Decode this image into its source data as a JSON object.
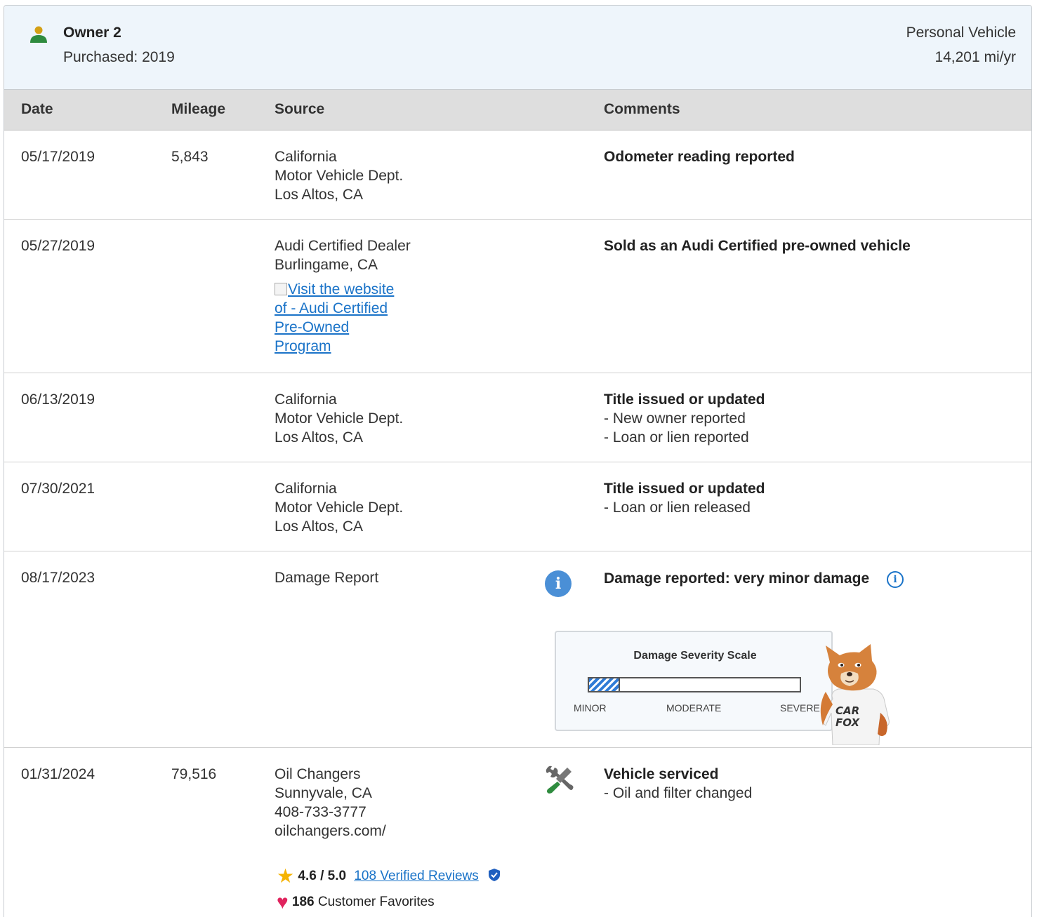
{
  "owner": {
    "title": "Owner 2",
    "purchased": "Purchased: 2019",
    "vehicle_type": "Personal Vehicle",
    "miles_per_year": "14,201 mi/yr"
  },
  "table": {
    "headers": {
      "date": "Date",
      "mileage": "Mileage",
      "source": "Source",
      "comments": "Comments"
    },
    "rows": [
      {
        "date": "05/17/2019",
        "mileage": "5,843",
        "source": [
          "California",
          "Motor Vehicle Dept.",
          "Los Altos, CA"
        ],
        "comment_title": "Odometer reading reported",
        "comment_items": []
      },
      {
        "date": "05/27/2019",
        "mileage": "",
        "source": [
          "Audi Certified Dealer",
          "Burlingame, CA"
        ],
        "link_text": "Visit the website of - Audi Certified Pre-Owned Program",
        "comment_title": "Sold as an Audi Certified pre-owned vehicle",
        "comment_items": []
      },
      {
        "date": "06/13/2019",
        "mileage": "",
        "source": [
          "California",
          "Motor Vehicle Dept.",
          "Los Altos, CA"
        ],
        "comment_title": "Title issued or updated",
        "comment_items": [
          "- New owner reported",
          "- Loan or lien reported"
        ]
      },
      {
        "date": "07/30/2021",
        "mileage": "",
        "source": [
          "California",
          "Motor Vehicle Dept.",
          "Los Altos, CA"
        ],
        "comment_title": "Title issued or updated",
        "comment_items": [
          "- Loan or lien released"
        ]
      },
      {
        "date": "08/17/2023",
        "mileage": "",
        "source": [
          "Damage Report"
        ],
        "comment_title": "Damage reported: very minor damage",
        "severity": {
          "title": "Damage Severity Scale",
          "level": 0.14,
          "labels": [
            "MINOR",
            "MODERATE",
            "SEVERE"
          ]
        }
      },
      {
        "date": "01/31/2024",
        "mileage": "79,516",
        "source": [
          "Oil Changers",
          "Sunnyvale, CA",
          "408-733-3777",
          "oilchangers.com/"
        ],
        "rating": "4.6 / 5.0",
        "reviews": "108 Verified Reviews",
        "favorites_count": "186",
        "favorites_label": "Customer Favorites",
        "comment_title": "Vehicle serviced",
        "comment_items": [
          "- Oil and filter changed"
        ]
      }
    ]
  },
  "colors": {
    "link": "#1a73c8",
    "info": "#4a8fd6",
    "header_bg": "#eef5fb",
    "table_head_bg": "#dedede",
    "severity_fill": "#2f7bd6"
  },
  "icons": [
    "person-icon",
    "info-icon",
    "info-outline-icon",
    "service-tools-icon",
    "star-icon",
    "verified-shield-icon",
    "heart-icon",
    "carfox-mascot"
  ]
}
